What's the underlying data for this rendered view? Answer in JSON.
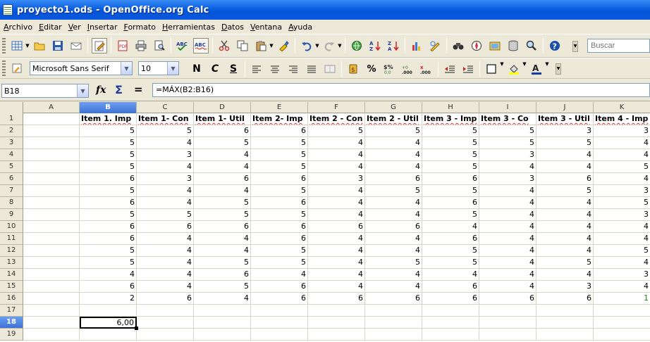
{
  "window": {
    "title": "proyecto1.ods - OpenOffice.org Calc"
  },
  "menu": [
    {
      "label": "Archivo",
      "mnemonic": "A",
      "rest": "rchivo"
    },
    {
      "label": "Editar",
      "mnemonic": "E",
      "rest": "ditar"
    },
    {
      "label": "Ver",
      "mnemonic": "V",
      "rest": "er"
    },
    {
      "label": "Insertar",
      "mnemonic": "I",
      "rest": "nsertar"
    },
    {
      "label": "Formato",
      "mnemonic": "F",
      "rest": "ormato"
    },
    {
      "label": "Herramientas",
      "mnemonic": "H",
      "rest": "erramientas"
    },
    {
      "label": "Datos",
      "mnemonic": "D",
      "rest": "atos"
    },
    {
      "label": "Ventana",
      "mnemonic": "V",
      "rest": "entana"
    },
    {
      "label": "Ayuda",
      "mnemonic": "A",
      "rest": "yuda"
    }
  ],
  "toolbar": {
    "search_placeholder": "Buscar",
    "font_name": "Microsoft Sans Serif",
    "font_size": "10",
    "bold": "N",
    "italic": "C",
    "underline": "S",
    "percent": "%"
  },
  "formula_bar": {
    "cell_ref": "B18",
    "fx": "fx",
    "sum": "Σ",
    "equals": "=",
    "formula": "=MÁX(B2:B16)"
  },
  "sheet": {
    "columns": [
      "A",
      "B",
      "C",
      "D",
      "E",
      "F",
      "G",
      "H",
      "I",
      "J",
      "K"
    ],
    "active_column": "B",
    "active_row": 18,
    "row_numbers": [
      1,
      2,
      3,
      4,
      5,
      6,
      7,
      8,
      9,
      10,
      11,
      12,
      13,
      14,
      15,
      16,
      17,
      18,
      19
    ],
    "headers": [
      "",
      "Item 1. Imp",
      "Item 1- Con",
      "Item 1- Util",
      "Item 2- Imp",
      "Item 2 - Con",
      "Item 2 - Util",
      "Item 3 - Imp",
      "Item 3 - Co",
      "Item 3 - Util",
      "Item 4 - Imp"
    ],
    "rows": [
      [
        5,
        5,
        6,
        6,
        5,
        5,
        5,
        5,
        3,
        3
      ],
      [
        5,
        4,
        5,
        5,
        4,
        4,
        5,
        5,
        5,
        4
      ],
      [
        5,
        3,
        4,
        5,
        4,
        4,
        5,
        3,
        4,
        4
      ],
      [
        5,
        4,
        4,
        5,
        4,
        4,
        5,
        4,
        4,
        5
      ],
      [
        6,
        3,
        6,
        6,
        3,
        6,
        6,
        3,
        6,
        4
      ],
      [
        5,
        4,
        4,
        5,
        4,
        5,
        5,
        4,
        5,
        3
      ],
      [
        6,
        4,
        5,
        6,
        4,
        4,
        6,
        4,
        4,
        5
      ],
      [
        5,
        5,
        5,
        5,
        4,
        4,
        5,
        4,
        4,
        3
      ],
      [
        6,
        6,
        6,
        6,
        6,
        6,
        4,
        4,
        4,
        4
      ],
      [
        6,
        4,
        4,
        6,
        4,
        4,
        6,
        4,
        4,
        4
      ],
      [
        5,
        4,
        4,
        5,
        4,
        4,
        5,
        4,
        4,
        5
      ],
      [
        5,
        4,
        5,
        5,
        4,
        5,
        5,
        4,
        5,
        4
      ],
      [
        4,
        4,
        6,
        4,
        4,
        4,
        4,
        4,
        4,
        3
      ],
      [
        6,
        4,
        5,
        6,
        4,
        4,
        6,
        4,
        3,
        4
      ],
      [
        2,
        6,
        4,
        6,
        6,
        6,
        6,
        6,
        6,
        1
      ]
    ],
    "result_cell": {
      "column": "B",
      "row": 18,
      "value": "6,00"
    }
  }
}
